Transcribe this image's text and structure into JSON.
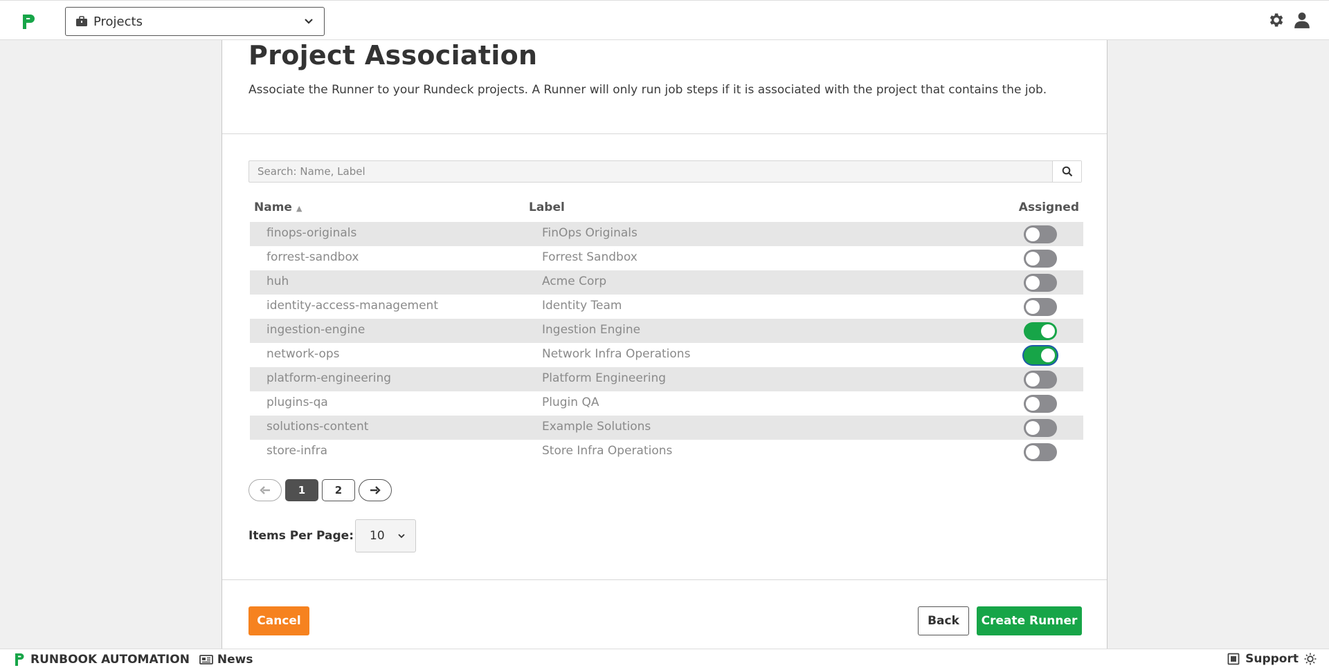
{
  "header": {
    "project_select_label": "Projects",
    "icons": [
      "logo-icon",
      "briefcase-icon",
      "chevron-down-icon",
      "gear-icon",
      "user-icon"
    ]
  },
  "main": {
    "title": "Project Association",
    "description": "Associate the Runner to your Rundeck projects. A Runner will only run job steps if it is associated with the project that contains the job.",
    "search_placeholder": "Search: Name, Label",
    "columns": {
      "name": "Name",
      "name_sort": "▲",
      "label": "Label",
      "assigned": "Assigned"
    },
    "rows": [
      {
        "name": "finops-originals",
        "label": "FinOps Originals",
        "assigned": false
      },
      {
        "name": "forrest-sandbox",
        "label": "Forrest Sandbox",
        "assigned": false
      },
      {
        "name": "huh",
        "label": "Acme Corp",
        "assigned": false
      },
      {
        "name": "identity-access-management",
        "label": "Identity Team",
        "assigned": false
      },
      {
        "name": "ingestion-engine",
        "label": "Ingestion Engine",
        "assigned": true
      },
      {
        "name": "network-ops",
        "label": "Network Infra Operations",
        "assigned": true
      },
      {
        "name": "platform-engineering",
        "label": "Platform Engineering",
        "assigned": false
      },
      {
        "name": "plugins-qa",
        "label": "Plugin QA",
        "assigned": false
      },
      {
        "name": "solutions-content",
        "label": "Example Solutions",
        "assigned": false
      },
      {
        "name": "store-infra",
        "label": "Store Infra Operations",
        "assigned": false
      }
    ],
    "pagination": {
      "pages": [
        "1",
        "2"
      ],
      "current": "1"
    },
    "items_per_page_label": "Items Per Page:",
    "items_per_page_value": "10",
    "buttons": {
      "cancel": "Cancel",
      "back": "Back",
      "create": "Create Runner"
    }
  },
  "footer": {
    "brand": "RUNBOOK AUTOMATION",
    "news": "News",
    "support": "Support"
  },
  "colors": {
    "brand_green": "#17a548",
    "cancel_orange": "#f6821f",
    "toggle_off": "#8c8c90"
  }
}
